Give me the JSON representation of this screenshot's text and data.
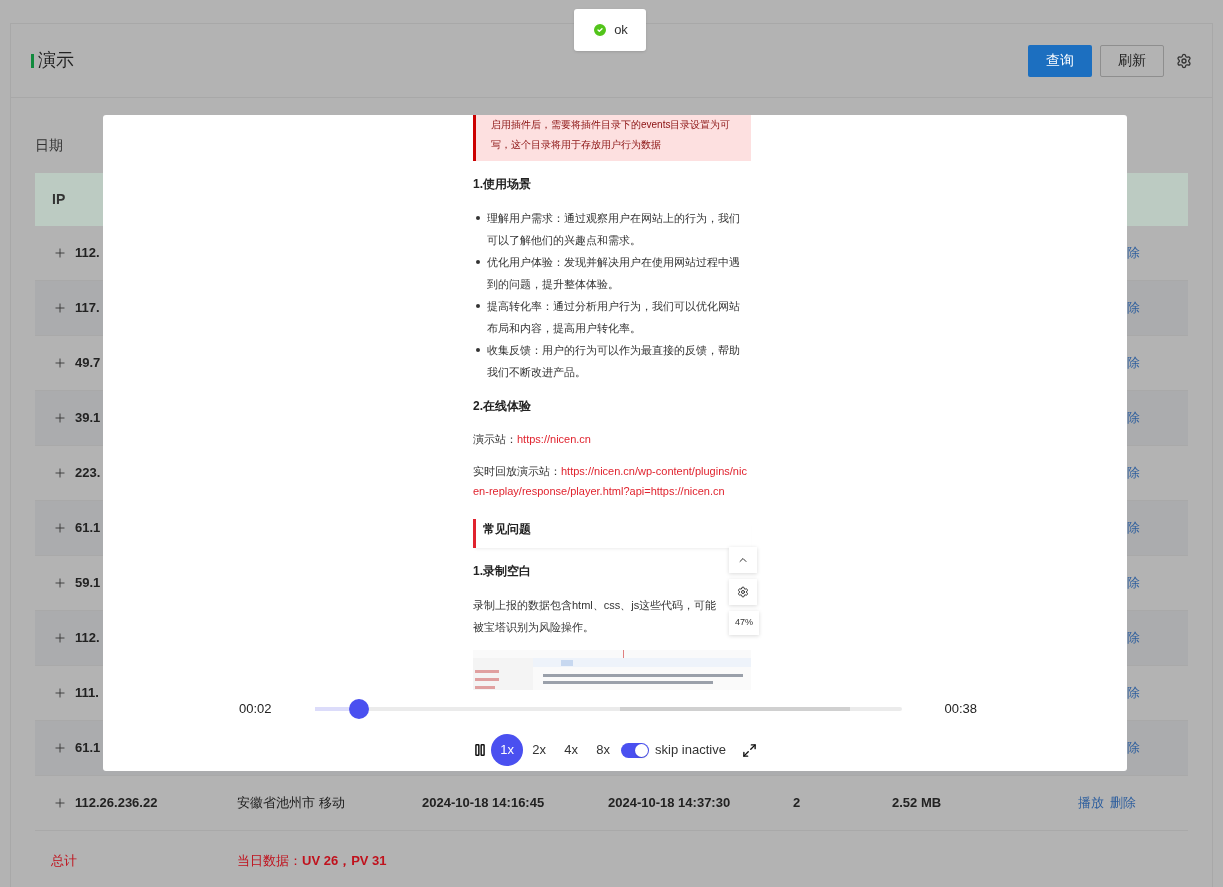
{
  "toast": {
    "kind": "success",
    "text": "ok"
  },
  "header": {
    "title": "演示",
    "buttons": [
      {
        "label": "查询",
        "kind": "primary"
      },
      {
        "label": "刷新",
        "kind": "default"
      }
    ]
  },
  "filter": {
    "label": "日期"
  },
  "table": {
    "columns": [
      "IP"
    ],
    "rows": [
      {
        "kind": "covered",
        "ip": "112.",
        "actions": [
          "除"
        ]
      },
      {
        "kind": "covered",
        "ip": "117.",
        "actions": [
          "除"
        ]
      },
      {
        "kind": "covered",
        "ip": "49.7",
        "actions": [
          "除"
        ]
      },
      {
        "kind": "covered",
        "ip": "39.1",
        "actions": [
          "除"
        ]
      },
      {
        "kind": "covered",
        "ip": "223.",
        "actions": [
          "除"
        ]
      },
      {
        "kind": "covered",
        "ip": "61.1",
        "actions": [
          "除"
        ]
      },
      {
        "kind": "covered",
        "ip": "59.1",
        "actions": [
          "除"
        ]
      },
      {
        "kind": "covered",
        "ip": "112.",
        "actions": [
          "除"
        ]
      },
      {
        "kind": "covered",
        "ip": "111.",
        "actions": [
          "除"
        ]
      },
      {
        "kind": "covered",
        "ip": "61.1",
        "actions": [
          "除"
        ]
      },
      {
        "kind": "full",
        "ip": "112.26.236.22",
        "location": "安徽省池州市 移动",
        "start": "2024-10-18 14:16:45",
        "end": "2024-10-18 14:37:30",
        "count": "2",
        "size": "2.52 MB",
        "actions": [
          "播放",
          "删除"
        ]
      }
    ]
  },
  "footer": {
    "label": "总计",
    "summary": "当日数据：**UV 26，PV 31**"
  },
  "recording": {
    "alert": "启用插件后，需要将插件目录下的events目录设置为可写，这个目录将用于存放用户行为数据",
    "blocks": [
      {
        "kind": "heading",
        "text": "1.使用场景"
      },
      {
        "kind": "list",
        "items": [
          "理解用户需求：通过观察用户在网站上的行为，我们可以了解他们的兴趣点和需求。",
          "优化用户体验：发现并解决用户在使用网站过程中遇到的问题，提升整体体验。",
          "提高转化率：通过分析用户行为，我们可以优化网站布局和内容，提高用户转化率。",
          "收集反馈：用户的行为可以作为最直接的反馈，帮助我们不断改进产品。"
        ]
      },
      {
        "kind": "heading",
        "text": "2.在线体验"
      },
      {
        "kind": "link",
        "text": "演示站：",
        "link": "https://nicen.cn"
      },
      {
        "kind": "link",
        "text": "实时回放演示站：",
        "link": "https://nicen.cn/wp-content/plugins/nicen-replay/response/player.html?api=https://nicen.cn"
      },
      {
        "kind": "section",
        "text": "常见问题"
      },
      {
        "kind": "heading",
        "text": "1.录制空白"
      },
      {
        "kind": "paragraph",
        "text": "录制上报的数据包含html、css、js这些代码，可能被宝塔识别为风险操作。"
      },
      {
        "kind": "picture"
      }
    ],
    "zoom": "47%"
  },
  "player": {
    "current": "00:02",
    "total": "00:38",
    "level": 0.075,
    "playing": true,
    "speeds": [
      {
        "label": "1x",
        "selected": true
      },
      {
        "label": "2x",
        "selected": false
      },
      {
        "label": "4x",
        "selected": false
      },
      {
        "label": "8x",
        "selected": false
      }
    ],
    "skip": {
      "label": "skip inactive",
      "on": true
    }
  }
}
